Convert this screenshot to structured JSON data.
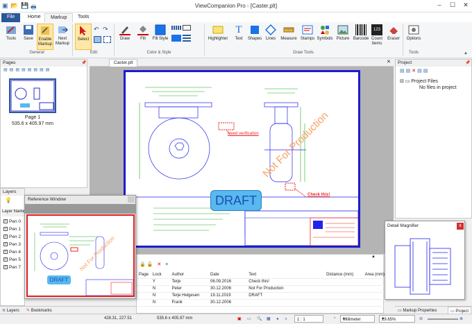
{
  "window": {
    "title": "ViewCompanion Pro - [Caster.plt]"
  },
  "menu": {
    "file": "File",
    "home": "Home",
    "markup": "Markup",
    "tools": "Tools"
  },
  "ribbon": {
    "tools": "Tools",
    "save": "Save",
    "enable_markup": "Enable Markup",
    "next_markup": "Next Markup",
    "select": "Select",
    "draw": "Draw",
    "fill": "Fill",
    "fill_style": "Fill Style",
    "highlighter": "Highlighter",
    "text": "Text",
    "shapes": "Shapes",
    "lines": "Lines",
    "measure": "Measure",
    "stamps": "Stamps",
    "symbols": "Symbols",
    "picture": "Picture",
    "barcode": "Barcode",
    "count_items": "Count Items",
    "eraser": "Eraser",
    "options": "Options",
    "groups": {
      "general": "General",
      "edit": "Edit",
      "color_style": "Color & Style",
      "draw_tools": "Draw Tools",
      "tools": "Tools"
    },
    "colors": {
      "draw": "#cc0000",
      "fill": "#cc0000",
      "fill_style": "#1a73e8"
    }
  },
  "pages_panel": {
    "title": "Pages",
    "page_label": "Page 1",
    "page_size": "535.6 x 405.97 mm"
  },
  "document_tab": "Caster.plt",
  "drawing": {
    "stamp": "DRAFT",
    "watermark": "Not For Production",
    "callout1": "Need verification",
    "callout2": "Check this!"
  },
  "layers_panel": {
    "title": "Layers",
    "header": "Layer Name",
    "pens": [
      "Pen 0",
      "Pen 1",
      "Pen 2",
      "Pen 3",
      "Pen 4",
      "Pen 5",
      "Pen 7"
    ]
  },
  "reference_window": {
    "title": "Reference Window",
    "stamp": "DRAFT",
    "watermark": "Not For Production"
  },
  "markup_table": {
    "columns": [
      "Page",
      "Lock",
      "Author",
      "Date",
      "Text",
      "Distance (mm)",
      "Area (mm)"
    ],
    "rows": [
      {
        "lock": "Y",
        "author": "Terje",
        "date": "06.09.2016",
        "text": "Check this!"
      },
      {
        "lock": "N",
        "author": "Peter",
        "date": "30.12.2006",
        "text": "Not For Production"
      },
      {
        "lock": "N",
        "author": "Terje Helgesen",
        "date": "19.11.2019",
        "text": "DRAFT"
      },
      {
        "lock": "N",
        "author": "Frank",
        "date": "30.12.2006",
        "text": ""
      }
    ]
  },
  "project_panel": {
    "title": "Project",
    "root": "Project Files",
    "empty": "No files in project"
  },
  "detail_magnifier": {
    "title": "Detail Magnifier"
  },
  "bottom_tabs": {
    "layers": "Layers",
    "bookmarks": "Bookmarks",
    "markup_properties": "Markup Properties",
    "project": "Project"
  },
  "status": {
    "coords": "428.31, 227.51",
    "size": "535.6 x 405.97 mm",
    "page": "1 : 1",
    "unit": "Millimeter",
    "zoom": "29.65%"
  }
}
